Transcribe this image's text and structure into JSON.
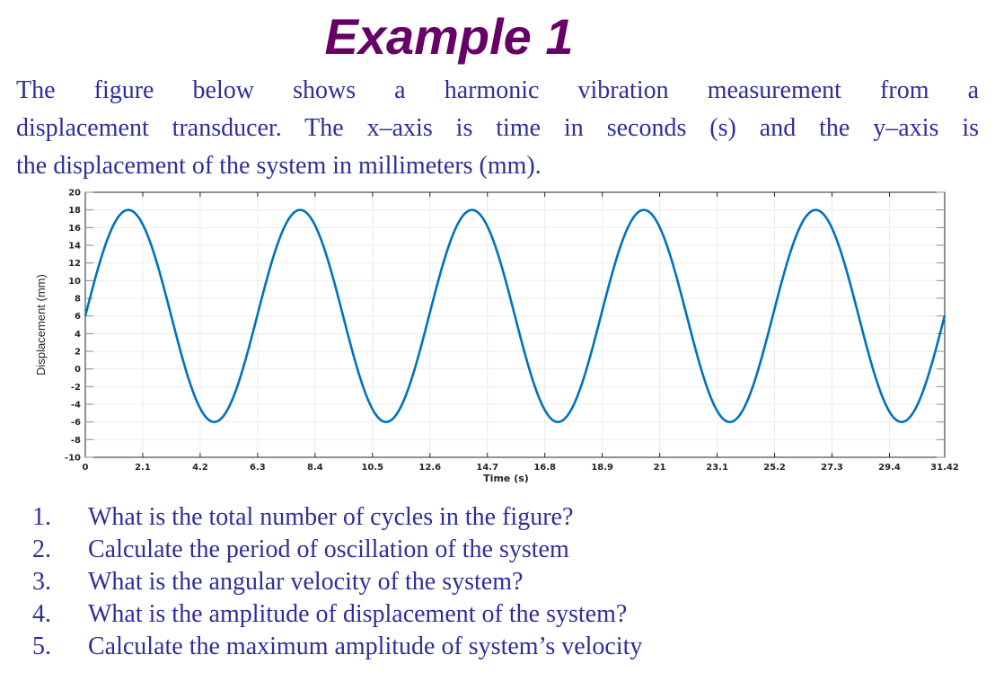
{
  "slide": {
    "title": "Example 1",
    "intro_lines": [
      "The figure below shows a harmonic vibration measurement from a",
      "displacement transducer.  The x–axis is time in seconds (s) and the y–axis is",
      "the displacement of the system in millimeters (mm)."
    ],
    "questions": [
      {
        "num": "1.",
        "text": "What is the total number of cycles in the figure?"
      },
      {
        "num": "2.",
        "text": "Calculate the period of oscillation of the system"
      },
      {
        "num": "3.",
        "text": "What is the angular velocity of the system?"
      },
      {
        "num": "4.",
        "text": "What is the amplitude of displacement of the system?"
      },
      {
        "num": "5.",
        "text": "Calculate the maximum amplitude of system’s velocity"
      }
    ]
  },
  "colors": {
    "title": "#660066",
    "body_text": "#2e2e9a",
    "series": "#0072bd",
    "grid": "#ebebeb",
    "axis": "#262626"
  },
  "chart_data": {
    "type": "line",
    "title": "",
    "xlabel": "Time (s)",
    "ylabel": "Displacement (mm)",
    "xlim": [
      0,
      31.42
    ],
    "ylim": [
      -10,
      20
    ],
    "grid": true,
    "xticks": [
      0,
      2.1,
      4.2,
      6.3,
      8.4,
      10.5,
      12.6,
      14.7,
      16.8,
      18.9,
      21,
      23.1,
      25.2,
      27.3,
      29.4,
      31.42
    ],
    "xtick_labels": [
      "0",
      "2.1",
      "4.2",
      "6.3",
      "8.4",
      "10.5",
      "12.6",
      "14.7",
      "16.8",
      "18.9",
      "21",
      "23.1",
      "25.2",
      "27.3",
      "29.4",
      "31.42"
    ],
    "yticks": [
      -10,
      -8,
      -6,
      -4,
      -2,
      0,
      2,
      4,
      6,
      8,
      10,
      12,
      14,
      16,
      18,
      20
    ],
    "ytick_labels": [
      "-10",
      "-8",
      "-6",
      "-4",
      "-2",
      "0",
      "2",
      "4",
      "6",
      "8",
      "10",
      "12",
      "14",
      "16",
      "18",
      "20"
    ],
    "series": [
      {
        "name": "displacement",
        "function": "y = 6 + 12*sin(t)",
        "offset": 6,
        "amplitude": 12,
        "angular_frequency": 1,
        "phase": 0,
        "t_start": 0,
        "t_end": 31.42,
        "cycles": 5,
        "max": 18,
        "min": -6
      }
    ],
    "legend": "none"
  }
}
